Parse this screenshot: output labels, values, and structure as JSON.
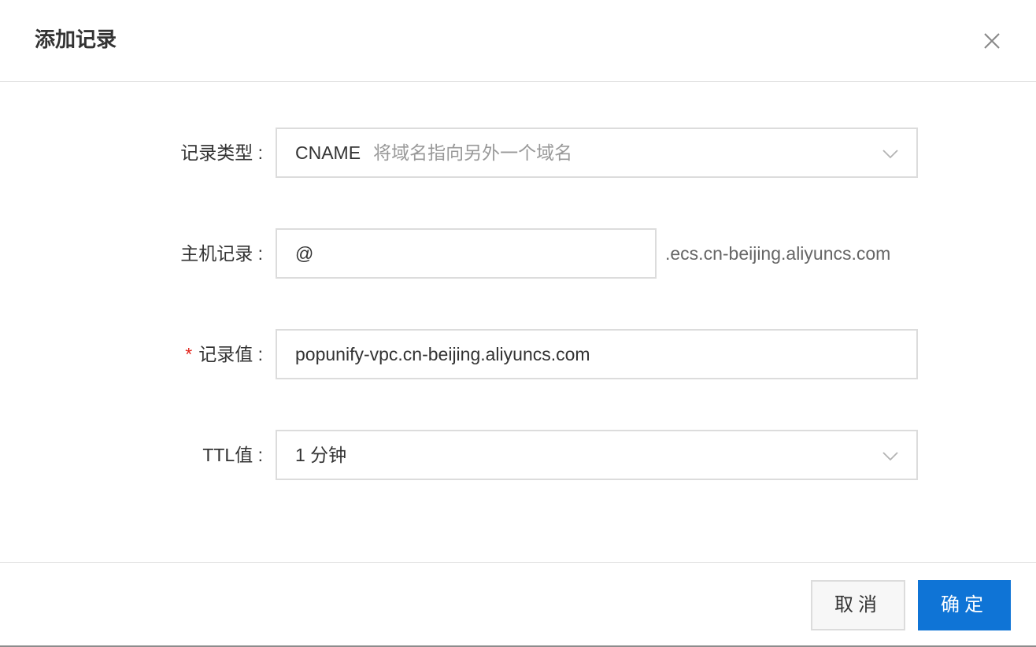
{
  "dialog": {
    "title": "添加记录"
  },
  "form": {
    "record_type": {
      "label": "记录类型 :",
      "value": "CNAME",
      "hint": "将域名指向另外一个域名"
    },
    "host_record": {
      "label": "主机记录 :",
      "value": "@",
      "suffix": ".ecs.cn-beijing.aliyuncs.com"
    },
    "record_value": {
      "required_mark": "*",
      "label": "记录值 :",
      "value": "popunify-vpc.cn-beijing.aliyuncs.com"
    },
    "ttl": {
      "label": "TTL值 :",
      "value": "1 分钟"
    }
  },
  "footer": {
    "cancel_label": "取消",
    "ok_label": "确定"
  },
  "icons": {
    "close": "close-icon",
    "dropdown": "chevron-down-icon"
  },
  "colors": {
    "primary": "#0f74d6",
    "required": "#e2231a",
    "border": "#dcdcdc",
    "hint_text": "#999999"
  }
}
